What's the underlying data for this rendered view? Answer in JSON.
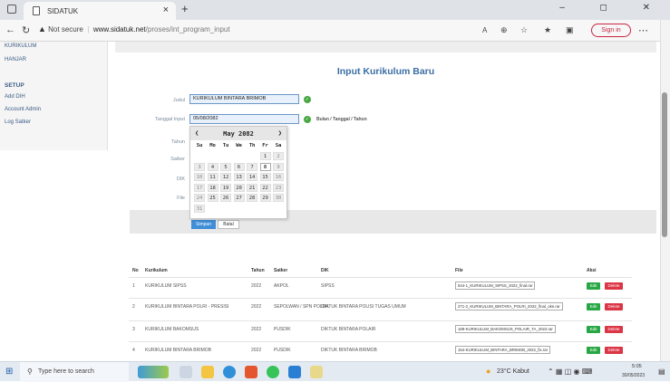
{
  "browser": {
    "tab_title": "SIDATUK",
    "close_tab": "×",
    "new_tab": "+",
    "window_controls": "–  ◻  ✕",
    "not_secure": "Not secure",
    "url_domain": "www.sidatuk.net",
    "url_path": "/proses/int_program_input",
    "sign_in": "Sign in"
  },
  "sidebar": {
    "items_top": [
      "KURIKULUM",
      "HANJAR"
    ],
    "setup_heading": "SETUP",
    "items_setup": [
      "Add DIH",
      "Account Admin",
      "Log Satker"
    ]
  },
  "form": {
    "title": "Input Kurikulum Baru",
    "judul_label": "Judul",
    "judul_value": "KURIKULUM BINTARA BRIMOB",
    "tanggal_label": "Tanggal Input",
    "tanggal_value": "05/08/2082",
    "tanggal_hint": "Bulan / Tanggal / Tahun",
    "tahun_label": "Tahun",
    "satker_label": "Satker",
    "dik_label": "DIK",
    "file_label": "File",
    "simpan": "Simpan",
    "batal": "Batal"
  },
  "calendar": {
    "month_label": "May 2082",
    "prev": "❮",
    "next": "❯",
    "weekdays": [
      "Su",
      "Mo",
      "Tu",
      "We",
      "Th",
      "Fr",
      "Sa"
    ],
    "selected_day": "8",
    "days": [
      [
        "",
        "",
        "",
        "",
        "",
        "1",
        "2"
      ],
      [
        "3",
        "4",
        "5",
        "6",
        "7",
        "8",
        "9"
      ],
      [
        "10",
        "11",
        "12",
        "13",
        "14",
        "15",
        "16"
      ],
      [
        "17",
        "18",
        "19",
        "20",
        "21",
        "22",
        "23"
      ],
      [
        "24",
        "25",
        "26",
        "27",
        "28",
        "29",
        "30"
      ],
      [
        "31",
        "",
        "",
        "",
        "",
        "",
        ""
      ]
    ]
  },
  "table": {
    "headers": [
      "No",
      "Kurikulum",
      "Tahun",
      "Satker",
      "DIK",
      "File",
      "Aksi"
    ],
    "edit_label": "Edit",
    "delete_label": "Delete",
    "rows": [
      [
        "1",
        "KURIKULUM SIPSS",
        "2022",
        "AKPOL",
        "SIPSS",
        "544-1_KURIKULUM_SIPSS_2022_final.rar"
      ],
      [
        "2",
        "KURIKULUM BINTARA POLRI - PRESISI",
        "2022",
        "SEPOLWAN / SPN POLDA",
        "DIKTUK BINTARA POLISI TUGAS UMUM",
        "271-2_KURIKULUM_BINTARA_POLRI_2022_final_oke.rar"
      ],
      [
        "3",
        "KURIKULUM BAKOMSUS",
        "2022",
        "PUSDIK",
        "DIKTUK BINTARA POLAIR",
        "189-KURIKULUM_BAKOMSUS_POLAIR_TA_2022.rar"
      ],
      [
        "4",
        "KURIKULUM BINTARA BRIMOB",
        "2022",
        "PUSDIK",
        "DIKTUK BINTARA BRIMOB",
        "154-KURIKULUM_BINTARA_BRIMOB_2022_fix.rar"
      ]
    ]
  },
  "taskbar": {
    "search_placeholder": "Type here to search",
    "weather": "23°C  Kabut",
    "time": "5:05",
    "date": "30/05/2023"
  }
}
